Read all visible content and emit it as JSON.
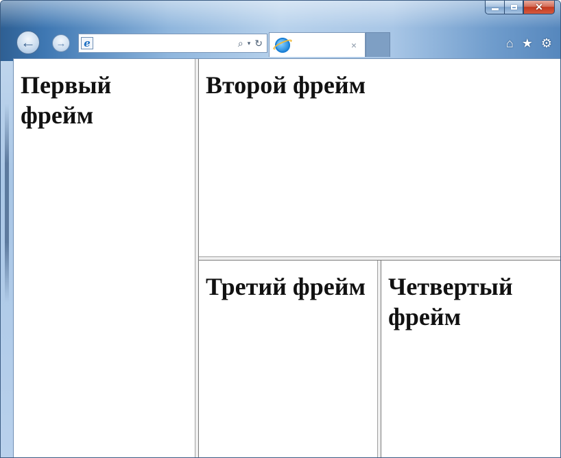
{
  "window": {
    "caption_buttons": {
      "minimize": "–",
      "maximize": "□",
      "close": "✕"
    }
  },
  "toolbar": {
    "back_glyph": "←",
    "forward_glyph": "→",
    "address": {
      "value": "",
      "placeholder": ""
    },
    "search_glyph": "⌕",
    "dropdown_glyph": "▾",
    "refresh_glyph": "↻",
    "icons": [
      "home-icon",
      "favorites-icon",
      "settings-icon"
    ],
    "home_glyph": "⌂",
    "favorites_glyph": "★",
    "settings_glyph": "⚙"
  },
  "tab": {
    "title": "",
    "close_glyph": "×"
  },
  "frames": {
    "first": "Первый фрейм",
    "second": "Второй фрейм",
    "third": "Третий фрейм",
    "fourth": "Четвертый фрейм"
  },
  "colors": {
    "frame_bg": "#ffffff",
    "heading_text": "#111111",
    "chrome_accent": "#3f78b3",
    "close_button": "#c2391f"
  }
}
